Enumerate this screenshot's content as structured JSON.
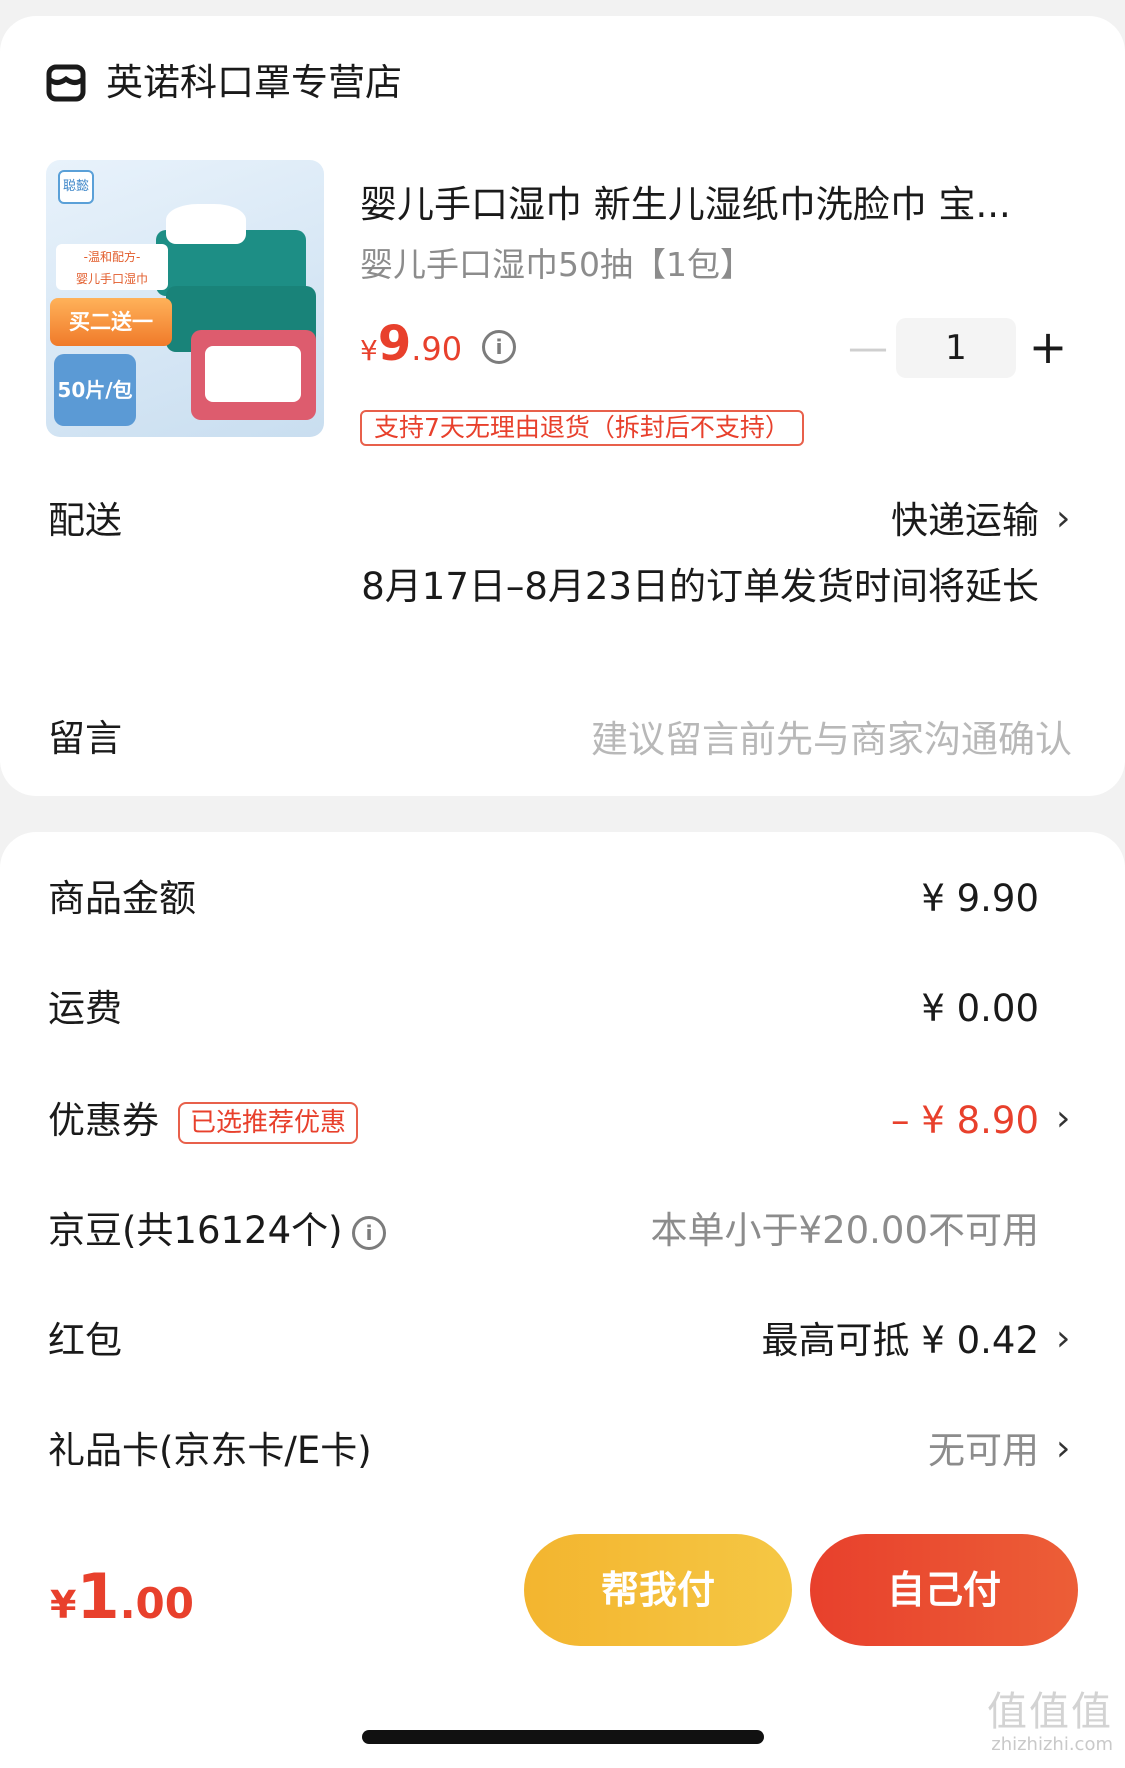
{
  "store": {
    "name": "英诺科口罩专营店",
    "icon": "store-icon"
  },
  "product": {
    "title": "婴儿手口湿巾 新生儿湿纸巾洗脸巾 宝...",
    "spec": "婴儿手口湿巾50抽【1包】",
    "price_yen": "¥",
    "price_int": "9",
    "price_dec": ".90",
    "quantity": "1",
    "minus": "—",
    "plus": "+",
    "return_policy": "支持7天无理由退货（拆封后不支持）",
    "image": {
      "brand": "聪懿",
      "tag_formula": "-温和配方-",
      "tag_formula_sub": "婴儿手口湿巾",
      "tag_promo": "买二送一",
      "tag_count": "50片/包"
    }
  },
  "delivery": {
    "label": "配送",
    "value": "快递运输",
    "note": "8月17日–8月23日的订单发货时间将延长"
  },
  "message": {
    "label": "留言",
    "placeholder": "建议留言前先与商家沟通确认"
  },
  "fees": {
    "goods_label": "商品金额",
    "goods_value": "¥ 9.90",
    "shipping_label": "运费",
    "shipping_value": "¥ 0.00",
    "coupon_label": "优惠券",
    "coupon_badge": "已选推荐优惠",
    "coupon_value": "– ¥ 8.90",
    "beans_label": "京豆(共16124个)",
    "beans_value": "本单小于¥20.00不可用",
    "redpacket_label": "红包",
    "redpacket_value": "最高可抵 ¥ 0.42",
    "giftcard_label": "礼品卡(京东卡/E卡)",
    "giftcard_value": "无可用"
  },
  "bottom": {
    "total_yen": "¥",
    "total_int": "1",
    "total_dec": ".00",
    "help_pay": "帮我付",
    "self_pay": "自己付"
  },
  "watermark": {
    "big": "值值值",
    "small": "zhizhizhi.com"
  },
  "colors": {
    "accent": "#e8402c",
    "help_button": "#f3b52f",
    "muted": "#8c8c8c"
  }
}
